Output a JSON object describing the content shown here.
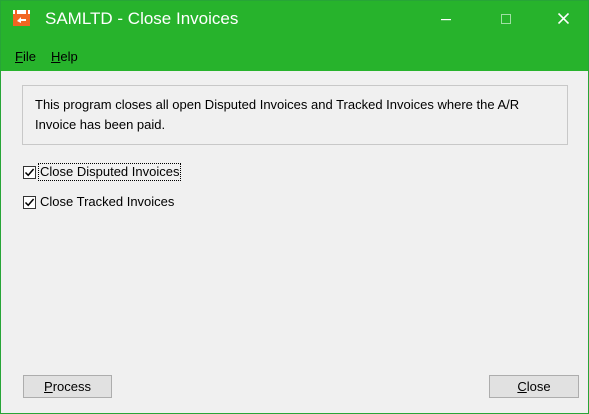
{
  "window": {
    "title": "SAMLTD - Close Invoices",
    "accent_color": "#27b32c",
    "controls": {
      "minimize_icon": "minimize-icon",
      "maximize_icon": "maximize-icon",
      "close_icon": "close-icon"
    }
  },
  "menu": {
    "file": {
      "accel": "F",
      "rest": "ile"
    },
    "help": {
      "accel": "H",
      "rest": "elp"
    }
  },
  "description": "This program closes all open Disputed Invoices and Tracked Invoices where the A/R Invoice has been paid.",
  "options": [
    {
      "label": "Close Disputed Invoices",
      "checked": true
    },
    {
      "label": "Close Tracked Invoices",
      "checked": true
    }
  ],
  "buttons": {
    "process": {
      "accel": "P",
      "rest": "rocess"
    },
    "close": {
      "accel": "C",
      "rest": "lose"
    }
  }
}
